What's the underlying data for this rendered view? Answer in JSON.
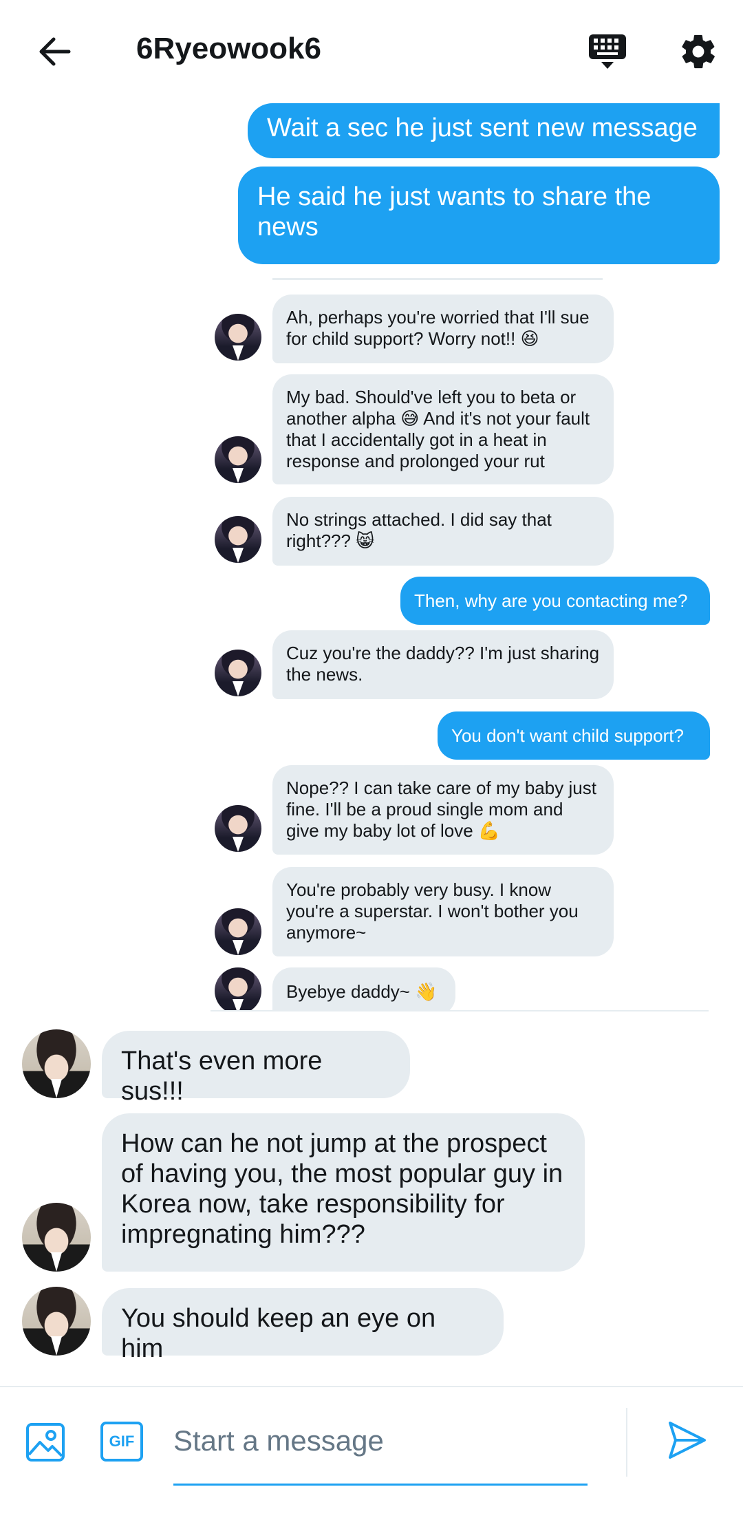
{
  "header": {
    "title": "6Ryeowook6"
  },
  "screenshot": {
    "outgoing_top": [
      "Wait a sec he just sent new message",
      "He said he just wants to share the news"
    ],
    "messages": [
      {
        "side": "left",
        "text": "Ah, perhaps you're worried that I'll sue for child support? Worry not!! 😆"
      },
      {
        "side": "left",
        "text": "My bad. Should've left you to beta or another alpha 😅 And it's not your fault that I accidentally got in a heat in response and prolonged your rut"
      },
      {
        "side": "left",
        "text": "No strings attached. I did say that right??? 😸"
      },
      {
        "side": "right",
        "text": "Then, why are you contacting me?"
      },
      {
        "side": "left",
        "text": "Cuz you're the daddy?? I'm just sharing the news."
      },
      {
        "side": "right",
        "text": "You don't want child support?"
      },
      {
        "side": "left",
        "text": "Nope?? I can take care of my baby just fine. I'll be a proud single mom and give my baby lot of love 💪"
      },
      {
        "side": "left",
        "text": "You're probably very busy. I know you're a superstar. I won't bother you anymore~"
      },
      {
        "side": "left",
        "text": "Byebye daddy~ 👋"
      }
    ]
  },
  "conversation": [
    "That's even more sus!!!",
    "How can he not jump at the prospect of having you, the most popular guy in Korea now, take responsibility for impregnating him???",
    "You should keep an eye on him"
  ],
  "composer": {
    "placeholder": "Start a message",
    "gif_label": "GIF"
  },
  "colors": {
    "accent": "#1da1f2",
    "bubble_gray": "#e6ecf0"
  }
}
